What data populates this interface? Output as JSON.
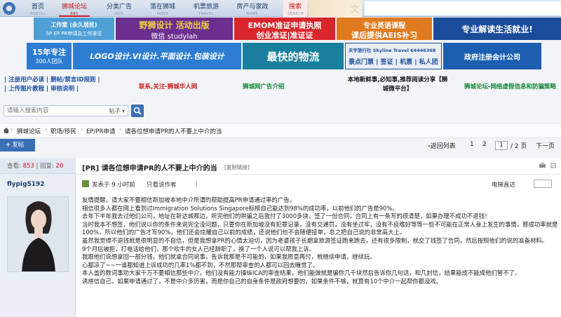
{
  "topnav": {
    "items": [
      {
        "label": "首页",
        "sub": "PORTAL"
      },
      {
        "label": "狮城论坛",
        "sub": "BBS"
      },
      {
        "label": "分类广告",
        "sub": "ADS"
      },
      {
        "label": "落在狮城",
        "sub": "MOVE"
      },
      {
        "label": "机票旅游",
        "sub": "TRAVEL"
      },
      {
        "label": "房产与家政",
        "sub": "HOME"
      },
      {
        "label": "搜索",
        "sub": "SEARCH"
      }
    ],
    "banner_text": "文"
  },
  "ads": {
    "row1": [
      {
        "main": "工作室 (永久居民)",
        "sub": "SP EP PR申请及工作准证",
        "bg": "#5aa6d8"
      },
      {
        "main": "野狮设计 活动出版",
        "sub": "微信 studylah",
        "bg": "#6b2f8f"
      },
      {
        "main": "EMOM准证申请执照",
        "sub": "创业准证|准证证",
        "bg": "#d9262c"
      },
      {
        "main": "专业英语课程",
        "sub": "课后提供AEIS补习",
        "bg": "#e07a1e"
      },
      {
        "main": "专业解读生活就业!",
        "sub": "",
        "bg": "#1b4c9a"
      }
    ],
    "row2": [
      {
        "main": "15年专注",
        "sub": "300人团队",
        "bg": "#2c7dd2"
      },
      {
        "main": "LOGO设计.VI设计.平面设计.包装设计",
        "sub": "",
        "bg": "#2c7dd2"
      },
      {
        "main": "最快的物流",
        "sub": "",
        "bg": "#1a7f9e"
      },
      {
        "main": "天宇旅行社 Skyline Travel 64446368",
        "sub": "景点门票 | 签证 | 机票 | 私人团",
        "bg": "#1f4f9a"
      },
      {
        "main": "政府注册会计公司",
        "sub": "",
        "bg": "#1c5fb0"
      }
    ]
  },
  "links": {
    "col1_line1": "| 注册用户必读 | 删帖/禁言ID规则 |",
    "col1_line2": "| 上传图片教程 | 审核说明 |",
    "col2": "联系,关注-狮城华人网",
    "col3": "狮城网广告介绍",
    "col4_line1": "本地新鲜事,必知事,推荐阅读分享【狮",
    "col4_line2": "城微平台】",
    "col5": "狮城论坛-网络虚假信息和防骗策略"
  },
  "search": {
    "placeholder": "请输入搜索内容",
    "scope": "帖子"
  },
  "breadcrumb": {
    "items": [
      "狮城论坛",
      "职场/移民",
      "EP/PR申请",
      "请各位想申请PR的人不要上中介的当"
    ]
  },
  "toolbar": {
    "post_label": "发帖",
    "back_label": "返回列表",
    "page1": "1",
    "page2": "2",
    "page_input": "1",
    "total_pages": "/ 2 页",
    "next_label": "下一页"
  },
  "thread": {
    "views_label": "查看:",
    "views": "853",
    "replies_label": "回复:",
    "replies": "20",
    "title": "[PR] 请各位想申请PR的人不要上中介的当",
    "copy_link": "[复制链接]",
    "author": "flypig5192",
    "posted_label": "发表于 9 小时前",
    "only_author": "只看该作者",
    "floor_label": "电梯直达",
    "body": [
      "友情提醒，请大家不要相信新加坡本地中介所谓的帮助提高PR申请通过率的广告。",
      "相信很多人都在网上看到过Immigration Solutions Singapore标榜自己能达到98%的成功率，以前他们的广告是90%。",
      "去年下半年我去过他们公司，地址在新达城那边，听完他们的哄骗之后我付了3000多块，签了一份合同，合同上有一条写的很清楚，如果办理不成功不退钱！",
      "当时我本不想签，他们说以你的条件来说完全没问题，只要你在新加坡没有犯罪记录，没有交通罚，没有坐过牢，没有不良嗜好等等一些不可能在正常人身上发生的事情，那成功率就是100%，所以他们的广告才写90%，他们还会炫耀自己以前的成绩，还说他们也不会随便接单，总之把自己说的非常高大上。",
      "虽然我觉得不退钱就是很明显的不自信，但是我想拿PR的心情太迫切，因为老婆孩子长期拿旅游签证跑来跑去，还有很多限制，就交了钱签了合同，然后按照他们的说的准备材料。",
      "9个月后被拒，打电话给他们，那个吹牛的女人已经辞职了，换了一个人说可以帮我上诉。",
      "我跟他们说想拿回一部分钱，他们就拿合同说事，告诉我那是不可能的，如果我愿意再付，就继续申请，继续玩。",
      "心都凉了~~一谁都知道上诉成功的几率1%都不到，不然那帮审查的人都可以回去睡觉了。",
      "本人盖的数词事劝大家千万不要相信那些中介，他们没有能力操纵ICA的审查结果，他们能做就是骗你几千块然后告诉你几句话，和几封信，结果能成不能成他们管不了。",
      "诱惑信自己，如果申请通过了，不是中介多历害，而是你自己的自身条件是政府想要的，如果条件不够，就算有10个中介一起帮你都没戏。"
    ]
  }
}
